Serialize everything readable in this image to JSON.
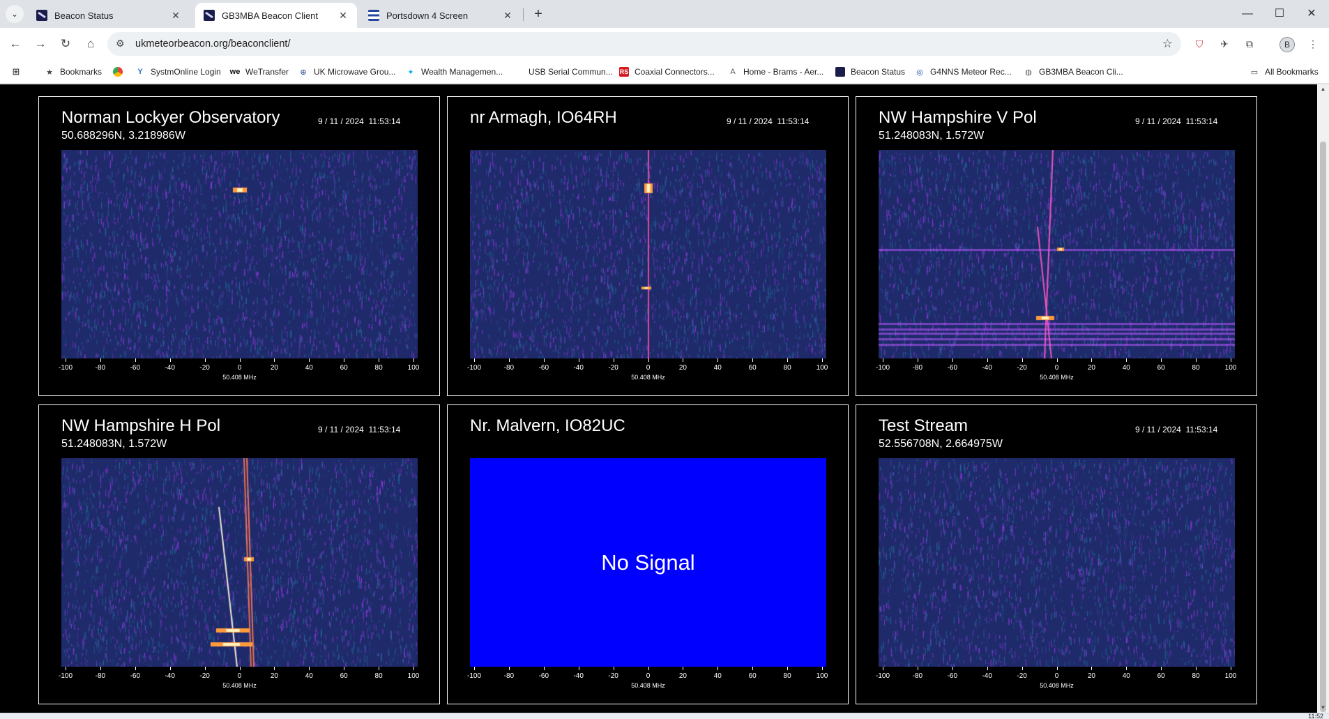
{
  "browser": {
    "tabs": [
      {
        "label": "Beacon Status",
        "icon": "beacon-favicon",
        "active": false
      },
      {
        "label": "GB3MBA Beacon Client",
        "icon": "beacon-favicon",
        "active": true
      },
      {
        "label": "Portsdown 4 Screen",
        "icon": "flag-favicon",
        "active": false
      }
    ],
    "new_tab": "+",
    "url": "ukmeteorbeacon.org/beaconclient/",
    "profile_initial": "B",
    "bookmarks": [
      {
        "label": "Bookmarks",
        "icon": "star-icon"
      },
      {
        "label": "",
        "icon": "chrome-icon"
      },
      {
        "label": "SystmOnline Login",
        "icon": "systmone-icon"
      },
      {
        "label": "WeTransfer",
        "icon": "wetransfer-icon"
      },
      {
        "label": "UK Microwave Grou...",
        "icon": "microwave-icon"
      },
      {
        "label": "Wealth Managemen...",
        "icon": "bank-icon"
      },
      {
        "label": "USB Serial Commun...",
        "icon": ""
      },
      {
        "label": "Coaxial Connectors...",
        "icon": "coax-icon"
      },
      {
        "label": "Home - Brams - Aer...",
        "icon": "brams-icon"
      },
      {
        "label": "Beacon Status",
        "icon": "beacon-favicon"
      },
      {
        "label": "G4NNS Meteor Rec...",
        "icon": "g4nns-icon"
      },
      {
        "label": "GB3MBA Beacon Cli...",
        "icon": "globe-icon"
      }
    ],
    "all_bookmarks": "All Bookmarks"
  },
  "axis": {
    "ticks": [
      "-100",
      "-80",
      "-60",
      "-40",
      "-20",
      "0",
      "20",
      "40",
      "60",
      "80",
      "100"
    ],
    "freq_label": "50.408 MHz"
  },
  "panels": [
    {
      "title": "Norman Lockyer Observatory",
      "coords": "50.688296N, 3.218986W",
      "date": "9 / 11 / 2024  11:53:14",
      "status": ""
    },
    {
      "title": "nr Armagh, IO64RH",
      "coords": "",
      "date": "9 / 11 / 2024  11:53:14",
      "status": ""
    },
    {
      "title": "NW Hampshire V Pol",
      "coords": "51.248083N, 1.572W",
      "date": "9 / 11 / 2024  11:53:14",
      "status": ""
    },
    {
      "title": "NW Hampshire H Pol",
      "coords": "51.248083N, 1.572W",
      "date": "9 / 11 / 2024  11:53:14",
      "status": ""
    },
    {
      "title": "Nr. Malvern, IO82UC",
      "coords": "",
      "date": "",
      "status": "No Signal"
    },
    {
      "title": "Test Stream",
      "coords": "52.556708N, 2.664975W",
      "date": "9 / 11 / 2024  11:53:14",
      "status": ""
    }
  ],
  "taskbar": {
    "time": "11:52"
  },
  "colors": {
    "waterfall_bg": "#1e2a6a",
    "no_signal_bg": "#0000ff",
    "page_bg": "#000000"
  }
}
